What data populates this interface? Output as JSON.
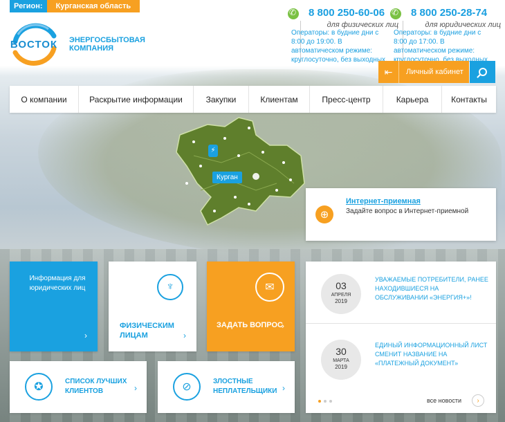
{
  "header": {
    "region_label": "Регион:",
    "region_value": "Курганская область",
    "logo_text": "ВОСТОК",
    "company_name": "ЭНЕРГОСБЫТОВАЯ КОМПАНИЯ",
    "phones": [
      {
        "number": "8 800 250-60-06",
        "for": "для физических лиц",
        "hours": "Операторы: в будние дни с 8:00 до 19:00. В автоматическом режиме: круглосуточно, без выходных."
      },
      {
        "number": "8 800 250-28-74",
        "for": "для юридических лиц",
        "hours": "Операторы: в будние дни с 8:00 до 17:00. В автоматическом режиме: круглосуточно, без выходных."
      }
    ],
    "cabinet_label": "Личный кабинет"
  },
  "nav": {
    "items": [
      "О компании",
      "Раскрытие информации",
      "Закупки",
      "Клиентам",
      "Пресс-центр",
      "Карьера",
      "Контакты"
    ]
  },
  "map": {
    "city_label": "Курган"
  },
  "reception": {
    "title": "Интернет-приемная",
    "description": "Задайте вопрос в Интернет-приемной"
  },
  "tiles": {
    "legal": "Информация для юридических лиц",
    "physical": "Физическим лицам",
    "ask": "Задать вопрос",
    "best": "Список лучших клиентов",
    "debtors": "Злостные неплательщики"
  },
  "news": {
    "items": [
      {
        "day": "03",
        "month": "апреля",
        "year": "2019",
        "title": "Уважаемые потребители, ранее находившиеся на обслуживании «ЭнергиЯ+»!"
      },
      {
        "day": "30",
        "month": "марта",
        "year": "2019",
        "title": "Единый информационный лист сменит название на «Платежный документ»"
      }
    ],
    "all_label": "все новости"
  },
  "colors": {
    "accent_blue": "#1aa1e0",
    "accent_orange": "#f7a021",
    "phone_green": "#7ac143",
    "region_green": "#5a7a2a"
  },
  "icons": {
    "phone": "phone-icon",
    "login": "login-icon",
    "search": "search-icon",
    "globe": "globe-icon",
    "tie": "tie-icon",
    "envelope": "envelope-icon",
    "medal": "medal-icon",
    "no-medal": "no-medal-icon",
    "arrow": "chevron-right-icon"
  }
}
